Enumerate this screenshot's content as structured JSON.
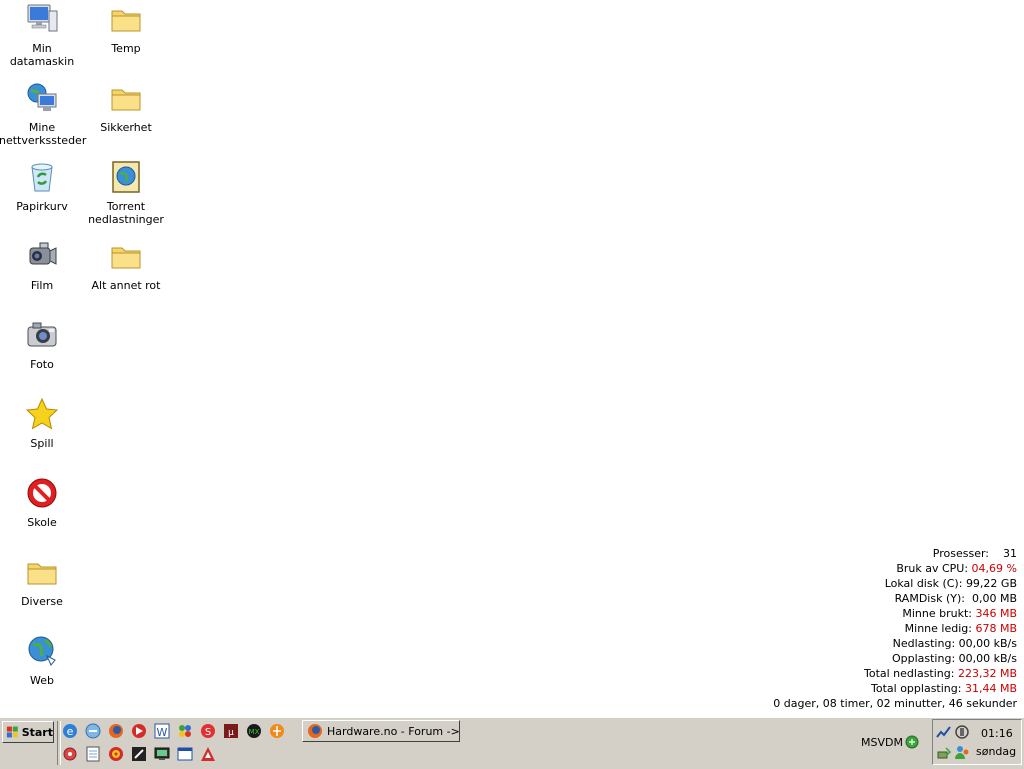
{
  "desktop": {
    "icons": [
      {
        "label": "Min datamaskin",
        "icon": "computer-icon"
      },
      {
        "label": "Mine nettverkssteder",
        "icon": "network-places-icon"
      },
      {
        "label": "Papirkurv",
        "icon": "recycle-bin-icon"
      },
      {
        "label": "Film",
        "icon": "video-camera-icon"
      },
      {
        "label": "Foto",
        "icon": "camera-icon"
      },
      {
        "label": "Spill",
        "icon": "star-icon"
      },
      {
        "label": "Skole",
        "icon": "no-entry-icon"
      },
      {
        "label": "Diverse",
        "icon": "folder-icon"
      },
      {
        "label": "Web",
        "icon": "globe-icon"
      },
      {
        "label": "Temp",
        "icon": "folder-icon"
      },
      {
        "label": "Sikkerhet",
        "icon": "folder-icon"
      },
      {
        "label": "Torrent nedlastninger",
        "icon": "torrent-globe-icon"
      },
      {
        "label": "Alt annet rot",
        "icon": "folder-icon"
      }
    ]
  },
  "stats": {
    "rows": [
      {
        "label": "Prosesser:",
        "value": "31",
        "red": false
      },
      {
        "label": "Bruk av CPU:",
        "value": "04,69 %",
        "red": true
      },
      {
        "label": "Lokal disk (C):",
        "value": "99,22 GB",
        "red": false
      },
      {
        "label": "RAMDisk (Y):",
        "value": "0,00 MB",
        "red": false
      },
      {
        "label": "Minne brukt:",
        "value": "346 MB",
        "red": true
      },
      {
        "label": "Minne ledig:",
        "value": "678 MB",
        "red": true
      },
      {
        "label": "Nedlasting:",
        "value": "00,00 kB/s",
        "red": false
      },
      {
        "label": "Opplasting:",
        "value": "00,00 kB/s",
        "red": false
      },
      {
        "label": "Total nedlasting:",
        "value": "223,32 MB",
        "red": true
      },
      {
        "label": "Total opplasting:",
        "value": "31,44 MB",
        "red": true
      }
    ],
    "uptime": "0 dager, 08 timer, 02 minutter, 46 sekunder"
  },
  "taskbar": {
    "start_label": "Start",
    "window_button": "Hardware.no - Forum ->...",
    "msvdm": "MSVDM",
    "clock": "01:16",
    "day": "søndag"
  },
  "colors": {
    "taskbar": "#d4d0c8",
    "desktop": "#ffffff",
    "stat_highlight": "#cc0000"
  }
}
